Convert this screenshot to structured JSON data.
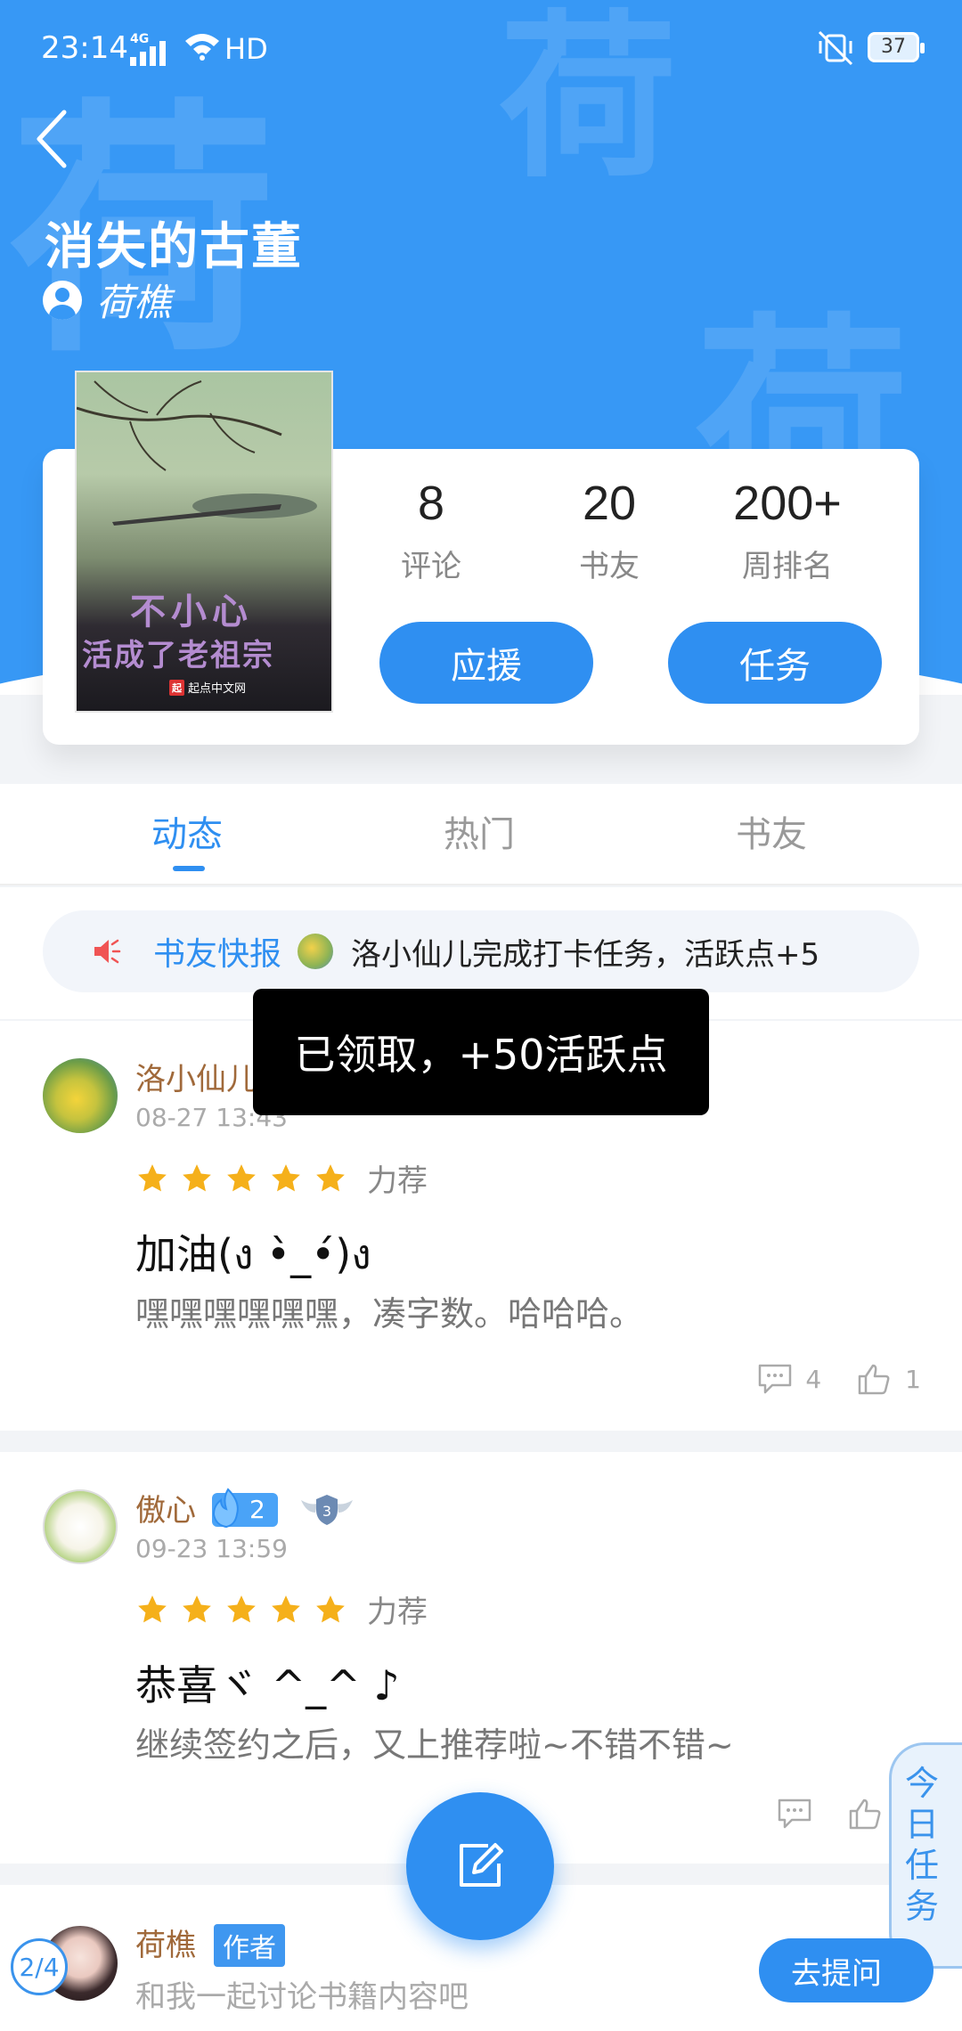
{
  "status_bar": {
    "time": "23:14",
    "network": "4G",
    "hd": "HD",
    "battery": "37"
  },
  "header": {
    "book_title": "消失的古董",
    "author": "荷樵",
    "background_color": "#3798f5",
    "watermark_char": "荷"
  },
  "book": {
    "cover_line1": "不小心",
    "cover_line2": "活成了老祖宗",
    "cover_publisher": "起点中文网",
    "cover_publisher_badge": "起"
  },
  "stats": [
    {
      "value": "8",
      "label": "评论"
    },
    {
      "value": "20",
      "label": "书友"
    },
    {
      "value": "200+",
      "label": "周排名"
    }
  ],
  "buttons": {
    "cheer": "应援",
    "task": "任务"
  },
  "tabs": {
    "items": [
      "动态",
      "热门",
      "书友"
    ],
    "active_index": 0
  },
  "news": {
    "label": "书友快报",
    "text": "洛小仙儿完成打卡任务，活跃点+5"
  },
  "toast": {
    "text": "已领取，+50活跃点"
  },
  "posts": [
    {
      "name": "洛小仙儿",
      "time": "08-27 13:43",
      "stars": 5,
      "rating_label": "力荐",
      "title": "加油(ง •̀_•́)ง",
      "body": "嘿嘿嘿嘿嘿嘿，凑字数。哈哈哈。",
      "comments": "4",
      "likes": "1"
    },
    {
      "name": "傲心",
      "fire_level": "2",
      "shield_level": "3",
      "time": "09-23 13:59",
      "stars": 5,
      "rating_label": "力荐",
      "title": "恭喜ヾ ^_^ ♪",
      "body": "继续签约之后，又上推荐啦~不错不错~"
    },
    {
      "name": "荷樵",
      "tag": "作者",
      "body": "和我一起讨论书籍内容吧"
    }
  ],
  "daily_task": {
    "label": "今日任务",
    "progress": "2/4"
  },
  "ask_button": "去提问",
  "colors": {
    "accent": "#2f8ff1",
    "star": "#f5b01a",
    "username": "#a0693a"
  }
}
